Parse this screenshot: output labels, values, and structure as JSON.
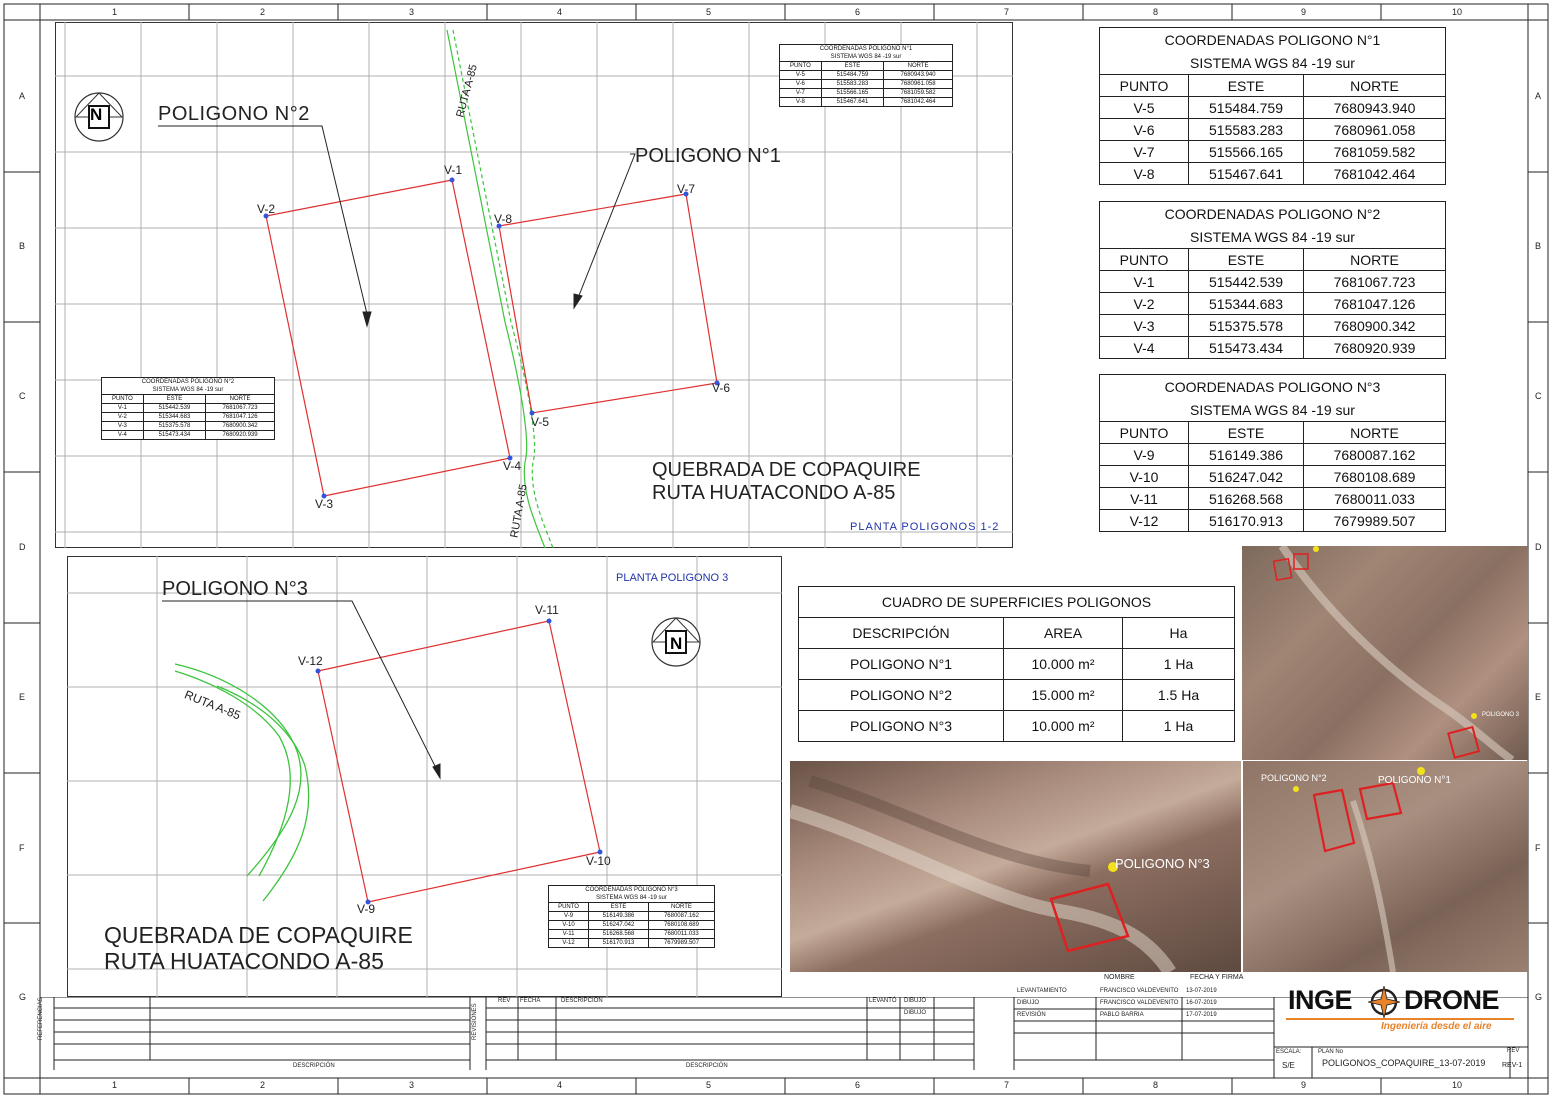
{
  "grid": {
    "cols": [
      "1",
      "2",
      "3",
      "4",
      "5",
      "6",
      "7",
      "8",
      "9",
      "10"
    ],
    "rows": [
      "A",
      "B",
      "C",
      "D",
      "E",
      "F",
      "G"
    ]
  },
  "plan1": {
    "heading": "PLANTA POLIGONOS 1-2",
    "poligono2_label": "POLIGONO N°2",
    "poligono1_label": "POLIGONO N°1",
    "ruta_label": "RUTA A-85",
    "quebrada_line1": "QUEBRADA DE COPAQUIRE",
    "quebrada_line2": "RUTA HUATACONDO A-85",
    "north": "N",
    "vertices": [
      "V-1",
      "V-2",
      "V-3",
      "V-4",
      "V-5",
      "V-6",
      "V-7",
      "V-8"
    ]
  },
  "plan2": {
    "heading": "PLANTA POLIGONO 3",
    "poligono3_label": "POLIGONO N°3",
    "ruta_label": "RUTA A-85",
    "quebrada_line1": "QUEBRADA DE COPAQUIRE",
    "quebrada_line2": "RUTA HUATACONDO A-85",
    "north": "N",
    "vertices": [
      "V-9",
      "V-10",
      "V-11",
      "V-12"
    ]
  },
  "coord_tables": [
    {
      "title": "COORDENADAS POLIGONO N°1",
      "system": "SISTEMA WGS 84 -19 sur",
      "headers": [
        "PUNTO",
        "ESTE",
        "NORTE"
      ],
      "rows": [
        [
          "V-5",
          "515484.759",
          "7680943.940"
        ],
        [
          "V-6",
          "515583.283",
          "7680961.058"
        ],
        [
          "V-7",
          "515566.165",
          "7681059.582"
        ],
        [
          "V-8",
          "515467.641",
          "7681042.464"
        ]
      ]
    },
    {
      "title": "COORDENADAS POLIGONO N°2",
      "system": "SISTEMA WGS 84 -19 sur",
      "headers": [
        "PUNTO",
        "ESTE",
        "NORTE"
      ],
      "rows": [
        [
          "V-1",
          "515442.539",
          "7681067.723"
        ],
        [
          "V-2",
          "515344.683",
          "7681047.126"
        ],
        [
          "V-3",
          "515375.578",
          "7680900.342"
        ],
        [
          "V-4",
          "515473.434",
          "7680920.939"
        ]
      ]
    },
    {
      "title": "COORDENADAS POLIGONO N°3",
      "system": "SISTEMA WGS 84 -19 sur",
      "headers": [
        "PUNTO",
        "ESTE",
        "NORTE"
      ],
      "rows": [
        [
          "V-9",
          "516149.386",
          "7680087.162"
        ],
        [
          "V-10",
          "516247.042",
          "7680108.689"
        ],
        [
          "V-11",
          "516268.568",
          "7680011.033"
        ],
        [
          "V-12",
          "516170.913",
          "7679989.507"
        ]
      ]
    }
  ],
  "superficies": {
    "title": "CUADRO DE SUPERFICIES POLIGONOS",
    "headers": [
      "DESCRIPCIÓN",
      "AREA",
      "Ha"
    ],
    "rows": [
      [
        "POLIGONO N°1",
        "10.000 m²",
        "1 Ha"
      ],
      [
        "POLIGONO N°2",
        "15.000 m²",
        "1.5 Ha"
      ],
      [
        "POLIGONO N°3",
        "10.000 m²",
        "1 Ha"
      ]
    ]
  },
  "photos": {
    "photo_pol3": "POLIGONO N°3",
    "photo_pol2": "POLIGONO N°2",
    "photo_pol1": "POLIGONO N°1",
    "photo_tr_pin": "POLIGONO 3"
  },
  "title_block": {
    "referencias": "REFERENCIAS",
    "revisiones": "REVISIONES",
    "descripcion": "DESCRIPCIÓN",
    "rev": "REV",
    "fecha": "FECHA",
    "levanto": "LEVANTÓ",
    "dibujo": "DIBUJO",
    "nombre": "NOMBRE",
    "fecha_firma": "FECHA Y FIRMA",
    "roles": [
      "LEVANTAMIENTO",
      "DIBUJO",
      "REVISIÓN"
    ],
    "names": [
      "FRANCISCO VALDEVENITO",
      "FRANCISCO VALDEVENITO",
      "PABLO BARRIA"
    ],
    "dates": [
      "13-07-2019",
      "16-07-2019",
      "17-07-2019"
    ],
    "escala_label": "ESCALA:",
    "escala": "S/E",
    "plan_no_label": "PLAN No",
    "plan_no": "POLIGONOS_COPAQUIRE_13-07-2019",
    "rev_label": "REV",
    "rev_value": "REV-1",
    "brand_left": "INGE",
    "brand_right": "DRONE",
    "tagline": "Ingeniería desde el aire"
  }
}
